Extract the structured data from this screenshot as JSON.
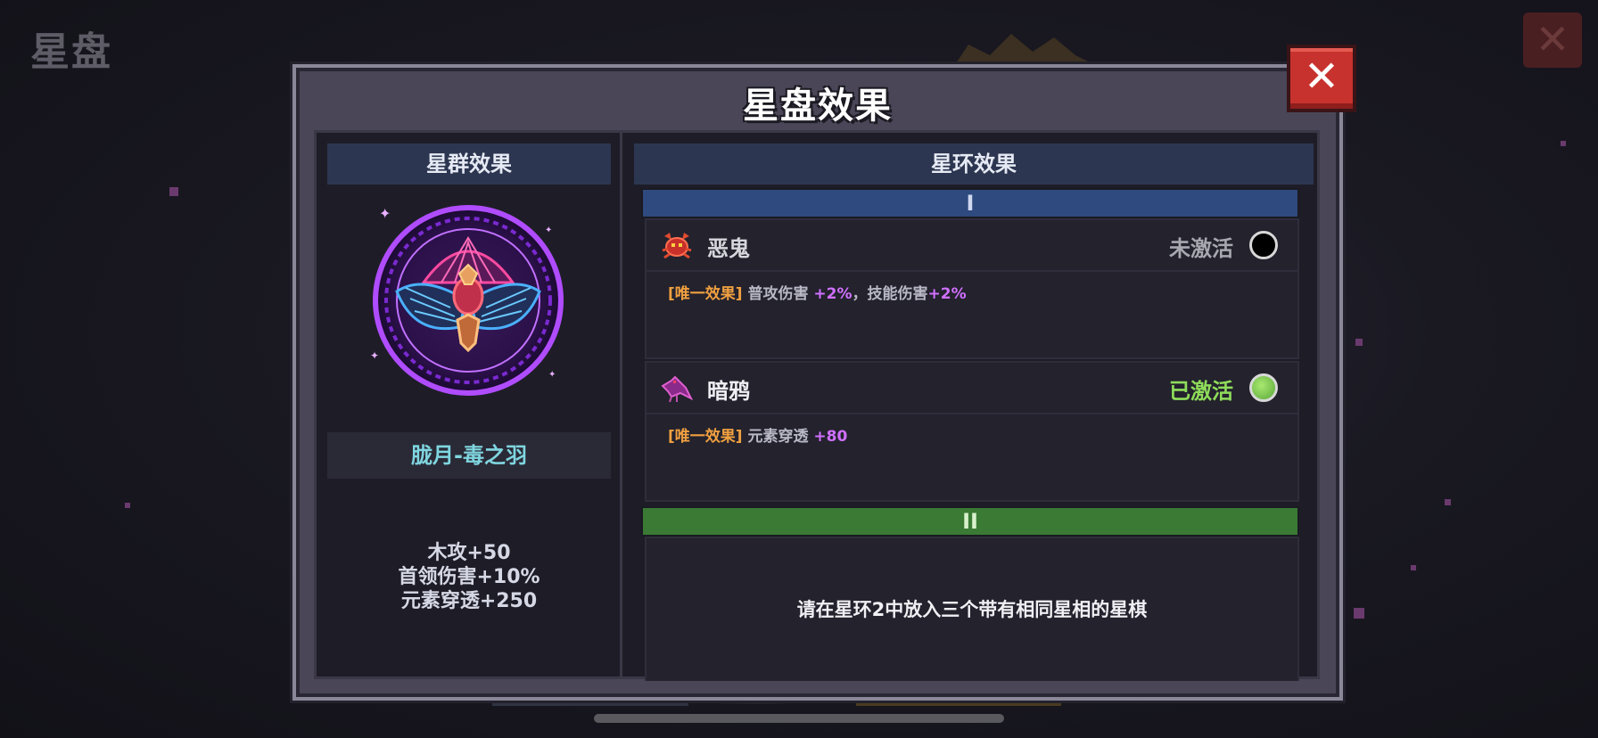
{
  "background": {
    "title": "星盘"
  },
  "modal": {
    "title": "星盘效果"
  },
  "left_panel": {
    "header": "星群效果",
    "emblem_icon": "purple-crow-constellation-icon",
    "emblem_name": "胧月-毒之羽",
    "stats": [
      "木攻+50",
      "首领伤害+10%",
      "元素穿透+250"
    ]
  },
  "right_panel": {
    "header": "星环效果",
    "tiers": [
      {
        "label": "I",
        "color": "#2e4a7e",
        "items": [
          {
            "name": "恶鬼",
            "icon": "red-crab-demon-icon",
            "status": "未激活",
            "status_color": "#a8a8b0",
            "dot_color": "#000000",
            "effect_tag": "[唯一效果]",
            "effect_text_1": "普攻伤害 ",
            "effect_val_1": "+2%",
            "effect_text_2": "，技能伤害",
            "effect_val_2": "+2%"
          },
          {
            "name": "暗鸦",
            "icon": "purple-crow-icon",
            "status": "已激活",
            "status_color": "#8fdc5a",
            "dot_color": "#6cbf3e",
            "effect_tag": "[唯一效果]",
            "effect_text_1": "元素穿透 ",
            "effect_val_1": "+80"
          }
        ]
      },
      {
        "label": "II",
        "color": "#3a7a34",
        "hint": "请在星环2中放入三个带有相同星相的星棋"
      }
    ]
  },
  "close_label": "✕"
}
